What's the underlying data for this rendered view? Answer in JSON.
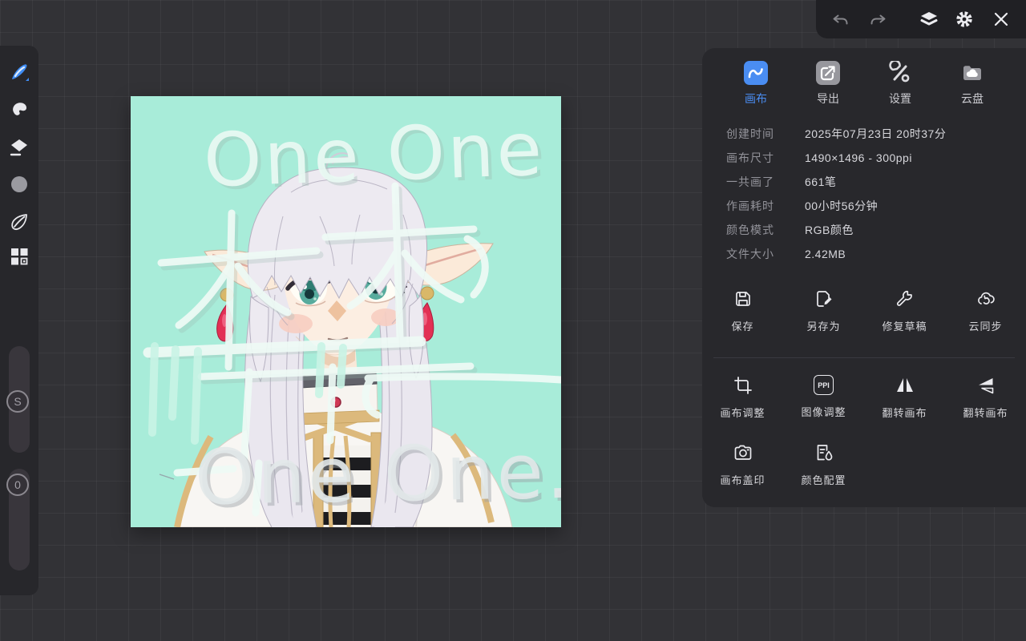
{
  "side_toolbar": {
    "slider_top_label": "S",
    "slider_bottom_label": "0"
  },
  "canvas": {
    "watermark_top": "One One",
    "watermark_bottom": "One One."
  },
  "panel": {
    "tabs": [
      {
        "label": "画布",
        "active": true
      },
      {
        "label": "导出",
        "active": false
      },
      {
        "label": "设置",
        "active": false
      },
      {
        "label": "云盘",
        "active": false
      }
    ],
    "info": [
      {
        "label": "创建时间",
        "value": "2025年07月23日 20时37分"
      },
      {
        "label": "画布尺寸",
        "value": "1490×1496 - 300ppi"
      },
      {
        "label": "一共画了",
        "value": "661笔"
      },
      {
        "label": "作画耗时",
        "value": "00小时56分钟"
      },
      {
        "label": "颜色模式",
        "value": "RGB颜色"
      },
      {
        "label": "文件大小",
        "value": "2.42MB"
      }
    ],
    "actions_row1": [
      {
        "label": "保存"
      },
      {
        "label": "另存为"
      },
      {
        "label": "修复草稿"
      },
      {
        "label": "云同步"
      }
    ],
    "actions_row2": [
      {
        "label": "画布调整"
      },
      {
        "label": "图像调整",
        "badge": "PPI"
      },
      {
        "label": "翻转画布"
      },
      {
        "label": "翻转画布"
      }
    ],
    "actions_row3": [
      {
        "label": "画布盖印"
      },
      {
        "label": "颜色配置"
      }
    ]
  },
  "colors": {
    "accent_blue": "#4a8df2",
    "canvas_mint": "#a8ecd9",
    "earring_red": "#e23054",
    "eye_teal": "#57ab9d"
  }
}
